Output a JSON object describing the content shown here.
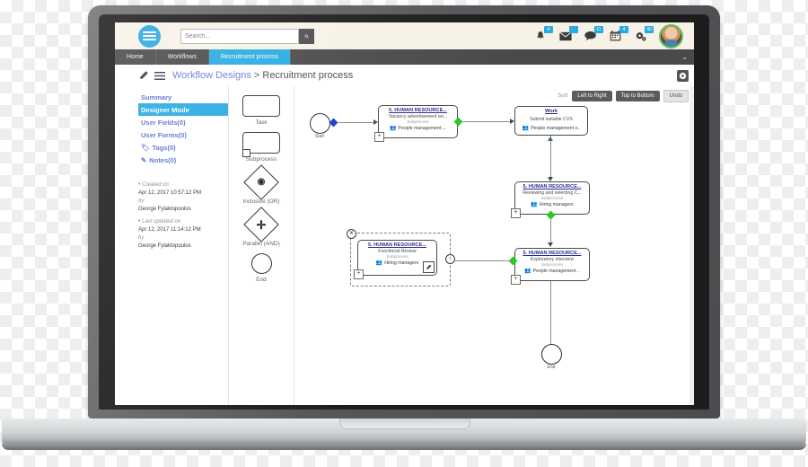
{
  "header": {
    "logo_name": "hamburger-logo",
    "search": {
      "placeholder": "Search...",
      "value": "",
      "button_icon": "search-icon"
    },
    "icons": [
      {
        "name": "bell-icon",
        "badge": "4"
      },
      {
        "name": "envelope-icon",
        "badge": ""
      },
      {
        "name": "chat-icon",
        "badge": "11"
      },
      {
        "name": "calendar-icon",
        "badge": "4"
      },
      {
        "name": "gear-icon",
        "badge": "40"
      }
    ],
    "avatar_label": "user-avatar"
  },
  "nav": {
    "tabs": [
      {
        "label": "Home",
        "active": false
      },
      {
        "label": "Workflows",
        "active": false
      },
      {
        "label": "Recruitment process",
        "active": true
      }
    ],
    "caret": "⌄"
  },
  "breadcrumb": {
    "edit_icon": "pencil-icon",
    "menu_icon": "list-icon",
    "parent": "Workflow Designs",
    "separator": " > ",
    "current": "Recruitment process",
    "settings_icon": "gear-icon"
  },
  "sidebar": {
    "items": [
      {
        "label": "Summary",
        "icon": "",
        "active": false
      },
      {
        "label": "Designer Mode",
        "icon": "",
        "active": true
      },
      {
        "label": "User Fields(0)",
        "icon": "",
        "active": false
      },
      {
        "label": "User Forms(0)",
        "icon": "",
        "active": false
      },
      {
        "label": "Tags(0)",
        "icon": "🏷",
        "active": false
      },
      {
        "label": "Notes(0)",
        "icon": "✎",
        "active": false
      }
    ],
    "meta": {
      "created_label": "Created on",
      "created_value": "Apr 12, 2017 10:57:12 PM",
      "created_by_label": "by",
      "created_by": "George Fylaktopoulos",
      "updated_label": "Last updated on",
      "updated_value": "Apr 12, 2017 11:14:12 PM",
      "updated_by_label": "by",
      "updated_by": "George Fylaktopoulos"
    }
  },
  "palette": {
    "items": [
      {
        "label": "Task",
        "shape": "rounded-rectangle"
      },
      {
        "label": "Subprocess",
        "shape": "rounded-rectangle-with-marker"
      },
      {
        "label": "Inclusive (OR)",
        "shape": "diamond-circle"
      },
      {
        "label": "Parallel (AND)",
        "shape": "diamond-plus"
      },
      {
        "label": "End",
        "shape": "circle"
      }
    ]
  },
  "toolbar": {
    "sort_label": "Sort",
    "left_to_right": "Left to Right",
    "top_to_bottom": "Top to Bottom",
    "undo": "Undo"
  },
  "canvas": {
    "start_label": "Start",
    "end_label": "End",
    "nodes": [
      {
        "id": "vacancy",
        "title": "5. HUMAN RESOURCE...",
        "subtitle": "Vacancy advertisement an...",
        "type": "Subprocess",
        "role": "People management ...",
        "role_icon": "users-icon"
      },
      {
        "id": "work",
        "title": "Work",
        "subtitle": "Submit suitable CVS",
        "type": "",
        "role": "People management o..",
        "role_icon": "users-icon"
      },
      {
        "id": "reviewing",
        "title": "5. HUMAN RESOURCE...",
        "subtitle": "Reviewing and selecting C...",
        "type": "Subprocess",
        "role": "Hiring managers",
        "role_icon": "users-icon"
      },
      {
        "id": "exploratory",
        "title": "5. HUMAN RESOURCE...",
        "subtitle": "Exploratory interview",
        "type": "Subprocess",
        "role": "People management ..",
        "role_icon": "users-icon"
      },
      {
        "id": "functional",
        "title": "5. HUMAN RESOURCE...",
        "subtitle": "Functional Review",
        "type": "Subprocess",
        "role": "Hiring managers",
        "role_icon": "users-icon",
        "selected": true,
        "edit_icon": "pencil-icon"
      }
    ],
    "colors": {
      "connector_green": "#22cc22",
      "connector_blue": "#1540c4",
      "accent": "#29abe2"
    }
  }
}
